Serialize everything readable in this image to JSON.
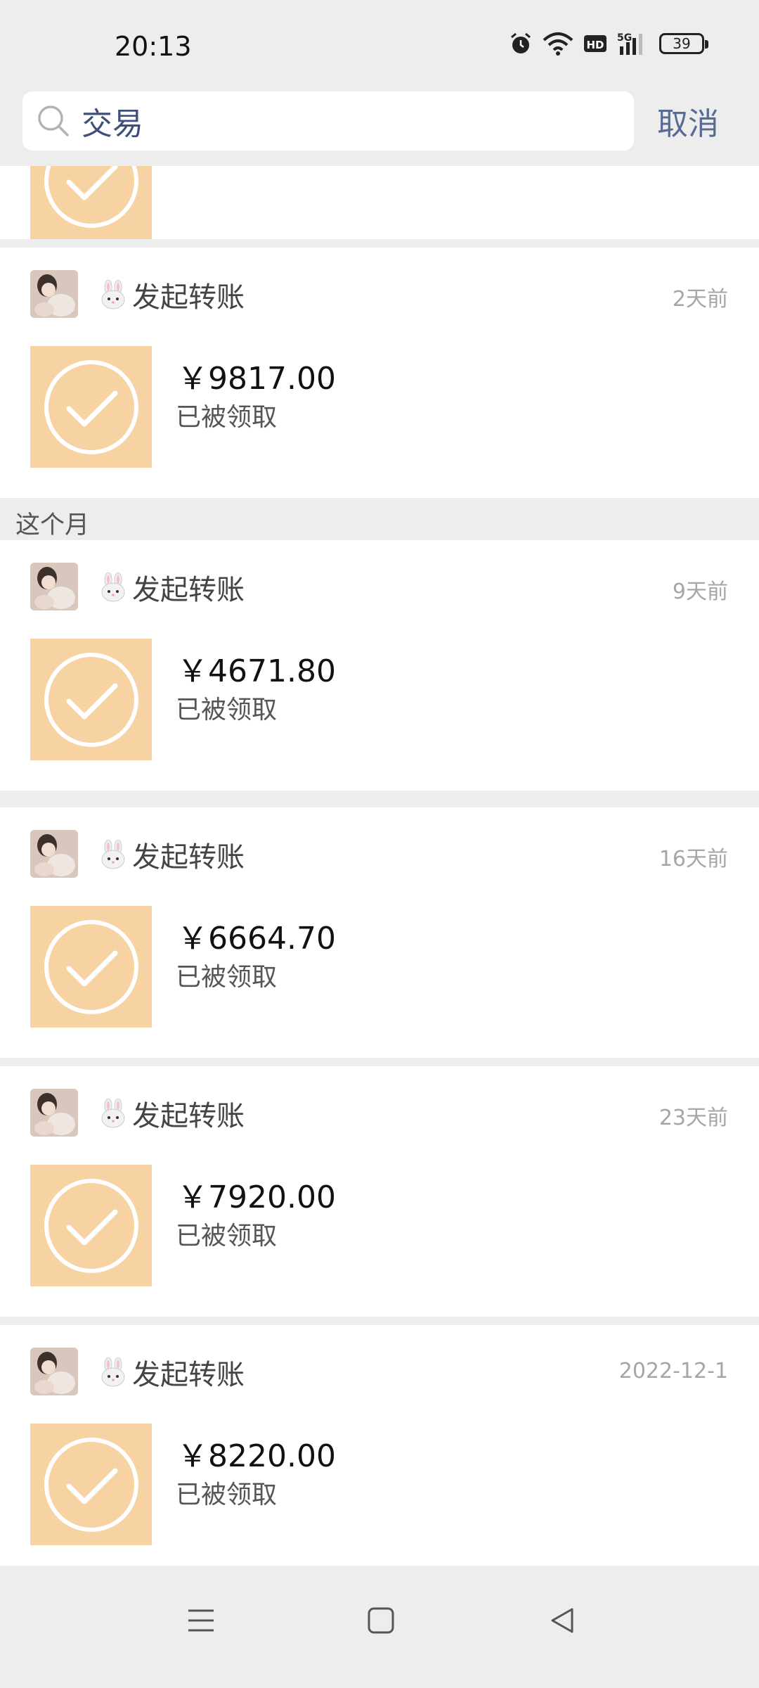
{
  "status_bar": {
    "time": "20:13",
    "battery": "39"
  },
  "search": {
    "query": "交易",
    "cancel_label": "取消"
  },
  "transactions": [
    {
      "sender": "发起转账",
      "time": "2天前",
      "amount": "￥9817.00",
      "status": "已被领取"
    },
    {
      "sender": "发起转账",
      "time": "9天前",
      "amount": "￥4671.80",
      "status": "已被领取"
    },
    {
      "sender": "发起转账",
      "time": "16天前",
      "amount": "￥6664.70",
      "status": "已被领取"
    },
    {
      "sender": "发起转账",
      "time": "23天前",
      "amount": "￥7920.00",
      "status": "已被领取"
    },
    {
      "sender": "发起转账",
      "time": "2022-12-1",
      "amount": "￥8220.00",
      "status": "已被领取"
    }
  ],
  "sections": {
    "this_month": "这个月"
  },
  "colors": {
    "envelope": "#f7d2a3",
    "link": "#576b95",
    "background": "#ededed"
  },
  "icons": [
    "search-icon",
    "alarm-icon",
    "wifi-icon",
    "hd-icon",
    "signal-icon",
    "battery-icon",
    "check-circle-icon",
    "menu-icon",
    "home-square-icon",
    "back-triangle-icon"
  ]
}
